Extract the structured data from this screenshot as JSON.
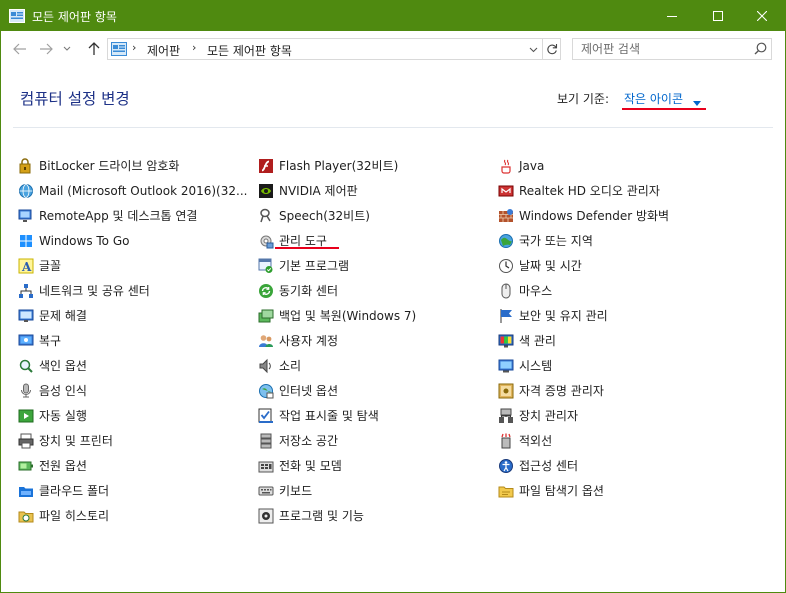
{
  "window": {
    "title": "모든 제어판 항목",
    "colors": {
      "titlebar": "#4f8a10",
      "heading": "#1e3287",
      "link": "#0066cc",
      "highlight": "#e8001c"
    }
  },
  "address": {
    "separator": "›",
    "crumbs": [
      "제어판",
      "모든 제어판 항목"
    ]
  },
  "search": {
    "placeholder": "제어판 검색"
  },
  "main": {
    "heading": "컴퓨터 설정 변경",
    "viewby_label": "보기 기준:",
    "viewby_value": "작은 아이콘"
  },
  "columns": [
    [
      {
        "label": "BitLocker 드라이브 암호화",
        "icon": "bitlocker-icon"
      },
      {
        "label": "Mail (Microsoft Outlook 2016)(32...",
        "icon": "mail-icon"
      },
      {
        "label": "RemoteApp 및 데스크톱 연결",
        "icon": "remoteapp-icon"
      },
      {
        "label": "Windows To Go",
        "icon": "windows-to-go-icon"
      },
      {
        "label": "글꼴",
        "icon": "fonts-icon"
      },
      {
        "label": "네트워크 및 공유 센터",
        "icon": "network-icon"
      },
      {
        "label": "문제 해결",
        "icon": "troubleshooting-icon"
      },
      {
        "label": "복구",
        "icon": "recovery-icon"
      },
      {
        "label": "색인 옵션",
        "icon": "indexing-icon"
      },
      {
        "label": "음성 인식",
        "icon": "speech-recognition-icon"
      },
      {
        "label": "자동 실행",
        "icon": "autoplay-icon"
      },
      {
        "label": "장치 및 프린터",
        "icon": "devices-printers-icon"
      },
      {
        "label": "전원 옵션",
        "icon": "power-icon"
      },
      {
        "label": "클라우드 폴더",
        "icon": "cloud-folder-icon"
      },
      {
        "label": "파일 히스토리",
        "icon": "file-history-icon"
      }
    ],
    [
      {
        "label": "Flash Player(32비트)",
        "icon": "flash-icon"
      },
      {
        "label": "NVIDIA 제어판",
        "icon": "nvidia-icon"
      },
      {
        "label": "Speech(32비트)",
        "icon": "speech-icon"
      },
      {
        "label": "관리 도구",
        "icon": "admin-tools-icon"
      },
      {
        "label": "기본 프로그램",
        "icon": "default-programs-icon"
      },
      {
        "label": "동기화 센터",
        "icon": "sync-icon"
      },
      {
        "label": "백업 및 복원(Windows 7)",
        "icon": "backup-icon"
      },
      {
        "label": "사용자 계정",
        "icon": "user-accounts-icon"
      },
      {
        "label": "소리",
        "icon": "sound-icon"
      },
      {
        "label": "인터넷 옵션",
        "icon": "internet-options-icon"
      },
      {
        "label": "작업 표시줄 및 탐색",
        "icon": "taskbar-icon"
      },
      {
        "label": "저장소 공간",
        "icon": "storage-spaces-icon"
      },
      {
        "label": "전화 및 모뎀",
        "icon": "phone-modem-icon"
      },
      {
        "label": "키보드",
        "icon": "keyboard-icon"
      },
      {
        "label": "프로그램 및 기능",
        "icon": "programs-features-icon"
      }
    ],
    [
      {
        "label": "Java",
        "icon": "java-icon"
      },
      {
        "label": "Realtek HD 오디오 관리자",
        "icon": "realtek-icon"
      },
      {
        "label": "Windows Defender 방화벽",
        "icon": "firewall-icon"
      },
      {
        "label": "국가 또는 지역",
        "icon": "region-icon"
      },
      {
        "label": "날짜 및 시간",
        "icon": "date-time-icon"
      },
      {
        "label": "마우스",
        "icon": "mouse-icon"
      },
      {
        "label": "보안 및 유지 관리",
        "icon": "security-maintenance-icon"
      },
      {
        "label": "색 관리",
        "icon": "color-management-icon"
      },
      {
        "label": "시스템",
        "icon": "system-icon"
      },
      {
        "label": "자격 증명 관리자",
        "icon": "credential-manager-icon"
      },
      {
        "label": "장치 관리자",
        "icon": "device-manager-icon"
      },
      {
        "label": "적외선",
        "icon": "infrared-icon"
      },
      {
        "label": "접근성 센터",
        "icon": "ease-of-access-icon"
      },
      {
        "label": "파일 탐색기 옵션",
        "icon": "file-explorer-options-icon"
      }
    ]
  ]
}
